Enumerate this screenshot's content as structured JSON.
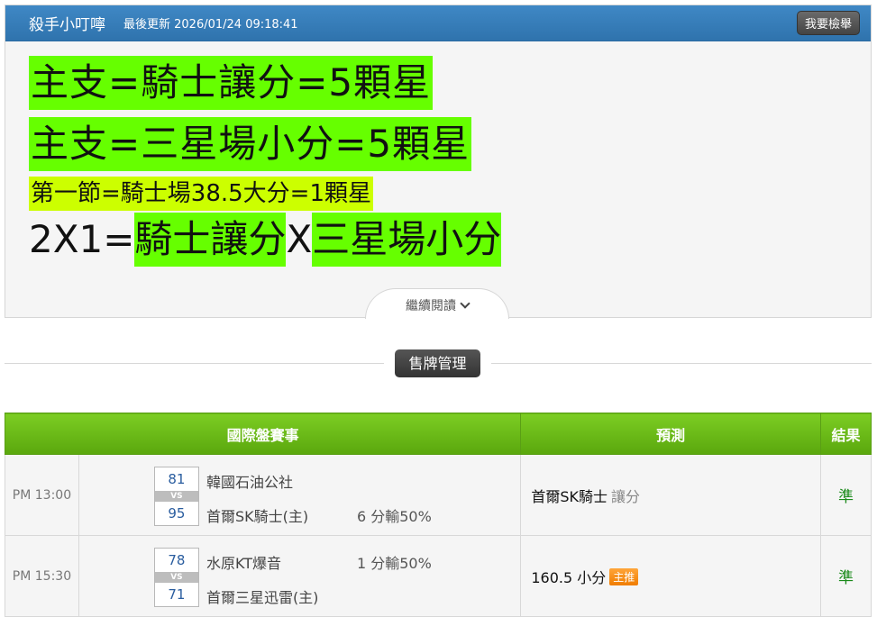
{
  "header": {
    "author": "殺手小叮嚀",
    "updated": "最後更新 2026/01/24 09:18:41",
    "report_label": "我要檢舉"
  },
  "article": {
    "line1": "主支=騎士讓分=5顆星",
    "line2": "主支=三星場小分=5顆星",
    "line3": "第一節=騎士場38.5大分=1顆星",
    "line4_prefix": "2X1=",
    "line4_a": "騎士讓分",
    "line4_x": "X",
    "line4_b": "三星場小分",
    "highlight_color": "#66ff00",
    "highlight_color_alt": "#ccff00"
  },
  "more_label": "繼續閱讀",
  "sell_label": "售牌管理",
  "table": {
    "headers": [
      "國際盤賽事",
      "預測",
      "結果"
    ],
    "rows": [
      {
        "time": "PM 13:00",
        "score_top": "81",
        "vs": "VS",
        "score_bottom": "95",
        "team_top": "韓國石油公社",
        "team_bottom": "首爾SK騎士(主)",
        "handicap_top": "",
        "handicap_bottom": "6 分輸50%",
        "prediction": "首爾SK騎士",
        "prediction_extra": "讓分",
        "tag": "",
        "result": "準"
      },
      {
        "time": "PM 15:30",
        "score_top": "78",
        "vs": "VS",
        "score_bottom": "71",
        "team_top": "水原KT爆音",
        "team_bottom": "首爾三星迅雷(主)",
        "handicap_top": "1 分輸50%",
        "handicap_bottom": "",
        "prediction": "160.5 小分",
        "prediction_extra": "",
        "tag": "主推",
        "result": "準"
      }
    ]
  },
  "colors": {
    "header_blue": "#3f88c5",
    "table_green": "#6cbb1a",
    "result_green": "#1a8a1a",
    "tag_orange": "#f58a0f"
  }
}
